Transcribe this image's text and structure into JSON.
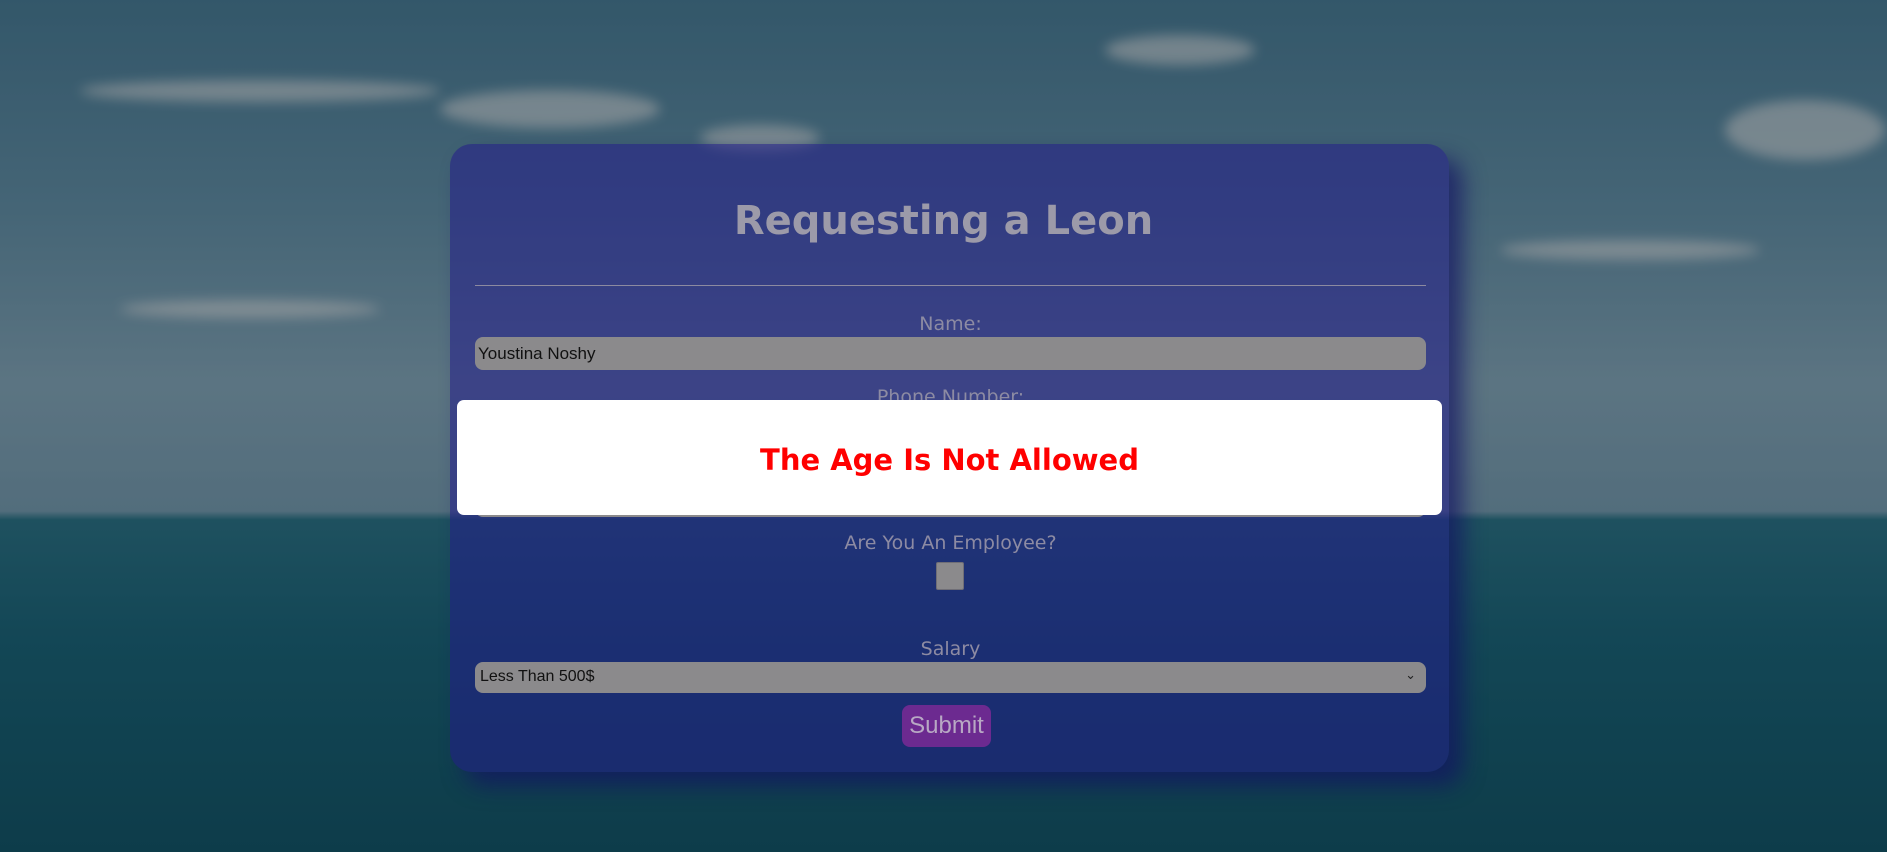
{
  "form": {
    "title": "Requesting a Leon",
    "name_label": "Name:",
    "name_value": "Youstina Noshy",
    "phone_label": "Phone Number:",
    "employee_label": "Are You An Employee?",
    "employee_checked": false,
    "salary_label": "Salary",
    "salary_selected": "Less Than 500$",
    "submit_label": "Submit"
  },
  "alert": {
    "message": "The Age Is Not Allowed",
    "color": "#ff0000"
  }
}
